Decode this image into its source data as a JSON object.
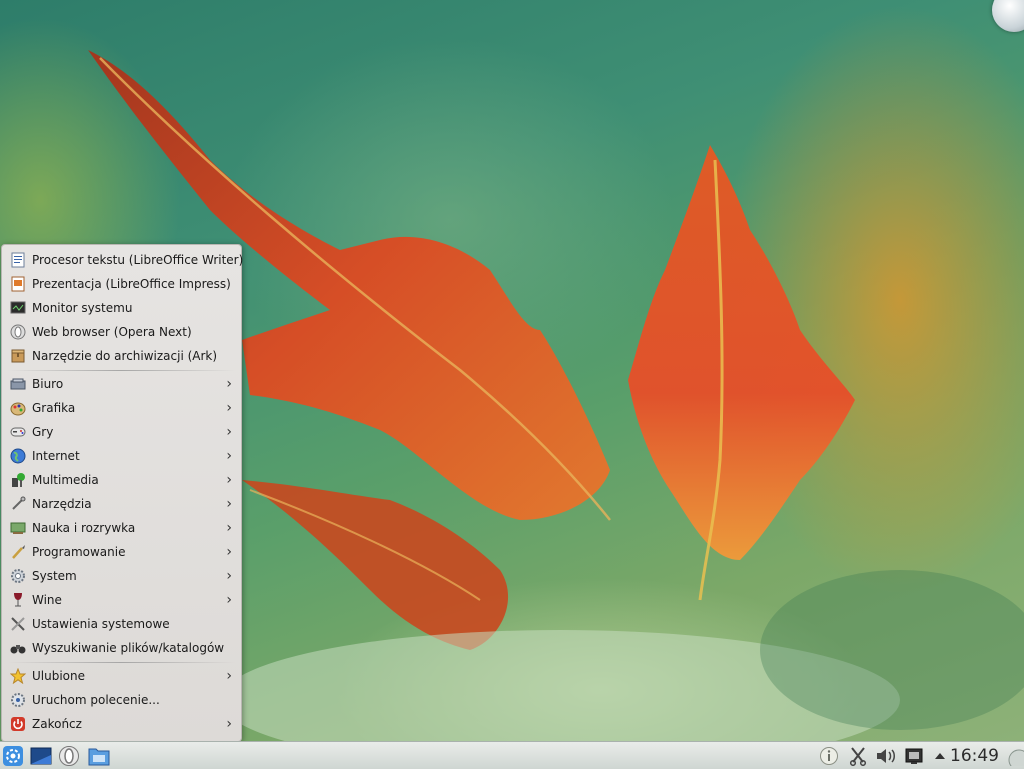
{
  "menu": {
    "recent": [
      {
        "label": "Procesor tekstu (LibreOffice Writer)",
        "icon": "writer-icon"
      },
      {
        "label": "Prezentacja (LibreOffice Impress)",
        "icon": "impress-icon"
      },
      {
        "label": "Monitor systemu",
        "icon": "system-monitor-icon"
      },
      {
        "label": "Web browser (Opera Next)",
        "icon": "opera-icon"
      },
      {
        "label": "Narzędzie do archiwizacji (Ark)",
        "icon": "ark-icon"
      }
    ],
    "categories": [
      {
        "label": "Biuro",
        "icon": "office-icon",
        "arrow": "›"
      },
      {
        "label": "Grafika",
        "icon": "graphics-icon",
        "arrow": "›"
      },
      {
        "label": "Gry",
        "icon": "games-icon",
        "arrow": "›"
      },
      {
        "label": "Internet",
        "icon": "internet-globe-icon",
        "arrow": "›"
      },
      {
        "label": "Multimedia",
        "icon": "multimedia-icon",
        "arrow": "›"
      },
      {
        "label": "Narzędzia",
        "icon": "tools-icon",
        "arrow": "›"
      },
      {
        "label": "Nauka i rozrywka",
        "icon": "education-icon",
        "arrow": "›"
      },
      {
        "label": "Programowanie",
        "icon": "development-icon",
        "arrow": "›"
      },
      {
        "label": "System",
        "icon": "system-gear-icon",
        "arrow": "›"
      },
      {
        "label": "Wine",
        "icon": "wine-glass-icon",
        "arrow": "›"
      },
      {
        "label": "Ustawienia systemowe",
        "icon": "settings-tools-icon"
      },
      {
        "label": "Wyszukiwanie plików/katalogów",
        "icon": "binoculars-icon"
      }
    ],
    "bottom": [
      {
        "label": "Ulubione",
        "icon": "star-icon",
        "arrow": "›"
      },
      {
        "label": "Uruchom polecenie...",
        "icon": "run-command-icon"
      },
      {
        "label": "Zakończ",
        "icon": "power-icon",
        "arrow": "›"
      }
    ]
  },
  "taskbar": {
    "clock": "16:49",
    "launchers": [
      "kde-launcher-icon",
      "desktop-icon",
      "opera-icon",
      "file-manager-icon"
    ],
    "tray": [
      "notifications-info-icon",
      "clipboard-scissors-icon",
      "volume-icon",
      "network-icon",
      "tray-expand-arrow-icon"
    ]
  },
  "colors": {
    "menu_bg": "#e2e0de",
    "taskbar_bg": "#dde2de",
    "leaf_red": "#d8431c",
    "leaf_orange": "#e8802a"
  }
}
